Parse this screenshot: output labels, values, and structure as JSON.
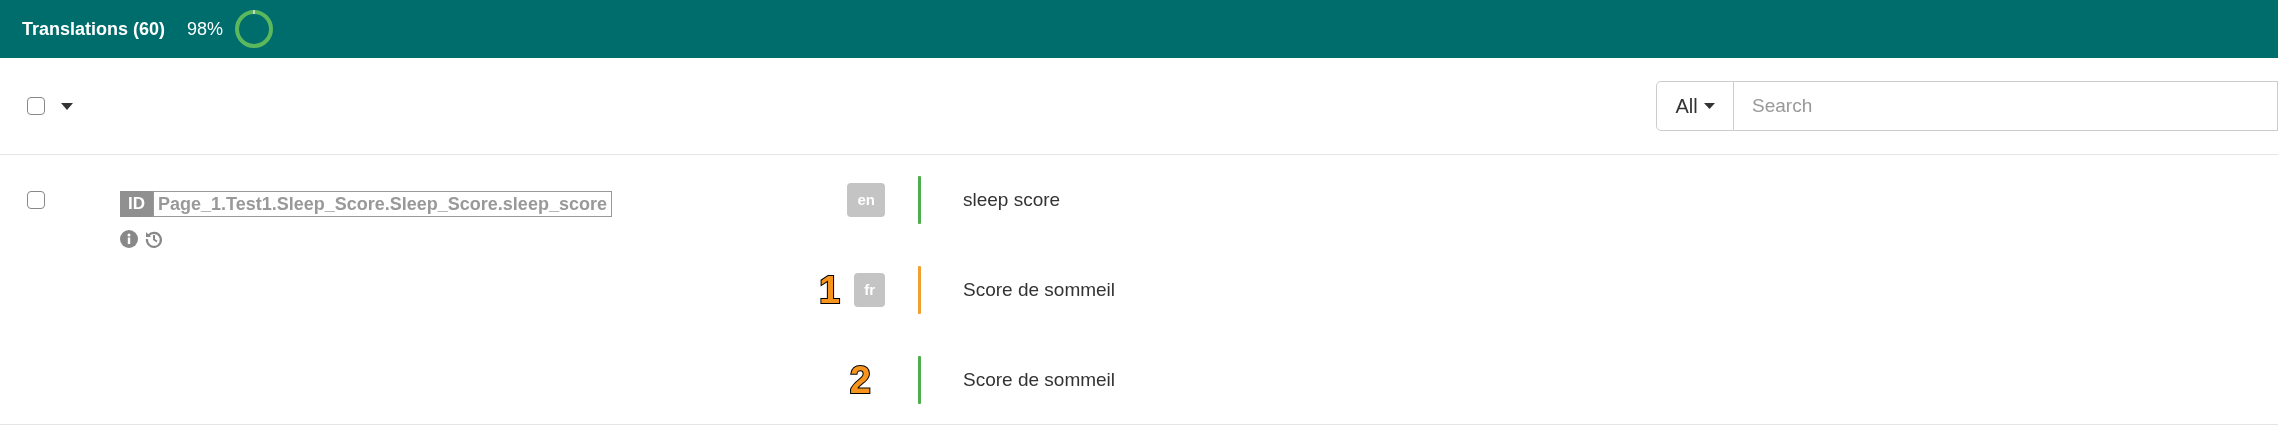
{
  "header": {
    "title": "Translations (60)",
    "percent": "98%"
  },
  "toolbar": {
    "select_all_checked": false,
    "filter": {
      "label": "All"
    },
    "search": {
      "placeholder": "Search"
    }
  },
  "entry": {
    "checked": false,
    "id_label": "ID",
    "key": "Page_1.Test1.Sleep_Score.Sleep_Score.sleep_score",
    "translations": [
      {
        "language": "en",
        "text": "sleep score",
        "color": "#4cae4c"
      },
      {
        "annotation": "1",
        "language": "fr",
        "text": "Score de sommeil",
        "color": "#f0a030"
      },
      {
        "annotation": "2",
        "text": "Score de sommeil",
        "color": "#4cae4c"
      }
    ]
  }
}
